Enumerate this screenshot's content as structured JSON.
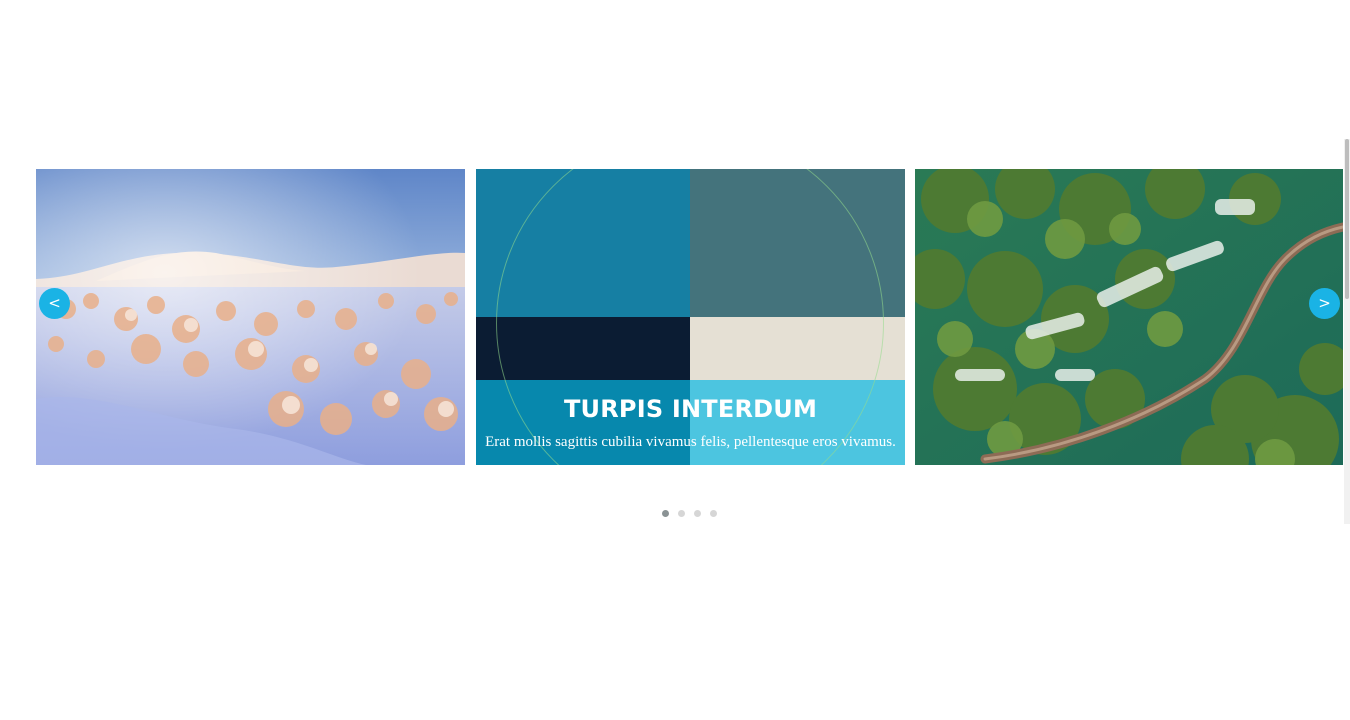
{
  "carousel": {
    "slides": [
      {
        "name": "snowy-landscape"
      },
      {
        "name": "turpis-interdum",
        "title": "TURPIS INTERDUM",
        "text": "Erat mollis sagittis cubilia vivamus felis, pellentesque eros vivamus."
      },
      {
        "name": "waterfalls-boardwalk"
      }
    ],
    "prev_label": "<",
    "next_label": ">",
    "dots": [
      {
        "active": true
      },
      {
        "active": false
      },
      {
        "active": false
      },
      {
        "active": false
      }
    ]
  },
  "colors": {
    "accent": "#1ab3e5",
    "dot_active": "#8a9294",
    "dot_inactive": "#d6d6d6"
  }
}
